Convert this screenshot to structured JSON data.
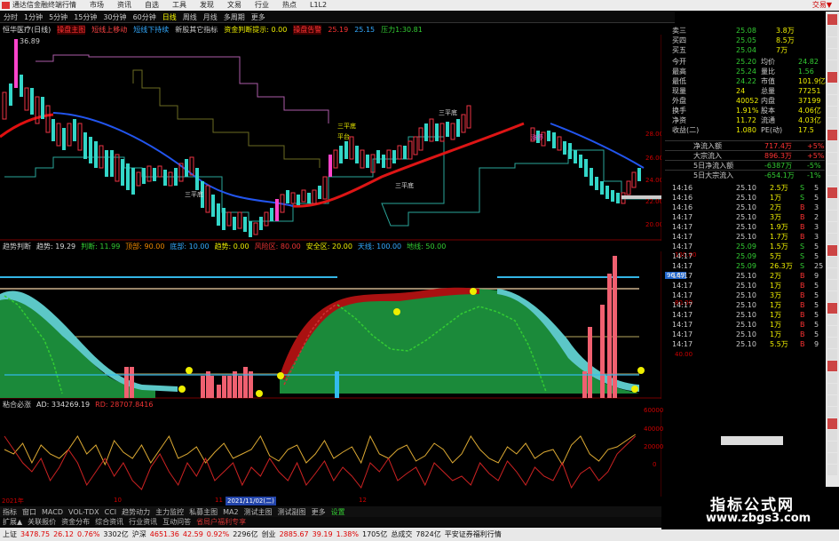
{
  "window": {
    "title": "通达信金融终端",
    "menus": [
      "行情",
      "市场",
      "资讯",
      "自选",
      "工具",
      "发现",
      "文易",
      "行业",
      "热点",
      "L1L2"
    ],
    "right_label": "交易▼"
  },
  "timeframes": {
    "items": [
      "分时",
      "1分钟",
      "5分钟",
      "15分钟",
      "30分钟",
      "60分钟",
      "日线",
      "周线",
      "月线",
      "多周期",
      "更多"
    ],
    "selected": "日线"
  },
  "main_indicator": {
    "stock": "恒华医疗(日线)",
    "items": [
      "操盘主图",
      "短线上移动",
      "短线下持续",
      "新股其它指标",
      "资金判断提示: 0.00",
      "操盘告警",
      "25.19",
      "25.15",
      "压力1:30.81"
    ],
    "price_high": "36.89",
    "labels": [
      "三平底",
      "三平底",
      "三平底",
      "三平底",
      "平台",
      "涨停"
    ]
  },
  "y_axis_main": [
    "28.00",
    "26.00",
    "24.00",
    "22.00",
    "20.00"
  ],
  "sub1": {
    "items": [
      "趋势判断",
      "趋势: 19.29",
      "判断: 11.99",
      "顶部: 90.00",
      "底部: 10.00",
      "趋势: 0.00",
      "风险区: 80.00",
      "安全区: 20.00",
      "天线: 100.00",
      "地线: 50.00"
    ],
    "y_axis": [
      "120.00",
      "80.00",
      "40.00"
    ],
    "marker": "96.69"
  },
  "sub2": {
    "items": [
      "粘合必涨",
      "AD: 334269.19",
      "RD: 28707.8416"
    ],
    "y_axis": [
      "60000",
      "40000",
      "20000",
      "0"
    ]
  },
  "date_axis": [
    "2021年",
    "10",
    "11",
    "2021/11/02(二)",
    "12"
  ],
  "bottom_tabs": [
    "指标",
    "窗口",
    "MACD",
    "VOL-TDX",
    "CCI",
    "趋势动力",
    "主力监控",
    "私募主图",
    "MA2",
    "测试主图",
    "测试副图",
    "更多",
    "设置"
  ],
  "bottom_tabs2": [
    "扩展▲",
    "关联报价",
    "资金分布",
    "综合资讯",
    "行业资讯",
    "互动问答",
    "省局户福利专享"
  ],
  "status": {
    "sh_label": "上证",
    "sh_val": "3478.75",
    "sh_chg": "26.12",
    "sh_pct": "0.76%",
    "sh_amt": "3302亿",
    "sz_label": "沪深",
    "sz_val": "4651.36",
    "sz_chg": "42.59",
    "sz_pct": "0.92%",
    "sz_amt": "2296亿",
    "cy_label": "创业",
    "cy_val": "2885.67",
    "cy_chg": "39.19",
    "cy_pct": "1.38%",
    "cy_amt": "1705亿",
    "total_label": "总成交",
    "total_amt": "7824亿",
    "broker": "平安证券福利行情"
  },
  "quote": {
    "top": [
      {
        "k": "卖三",
        "v": "25.08",
        "n": "3.8万"
      },
      {
        "k": "买四",
        "v": "25.05",
        "n": "8.5万"
      },
      {
        "k": "买五",
        "v": "25.04",
        "n": "7万"
      }
    ],
    "stats": [
      {
        "k1": "今开",
        "v1": "25.20",
        "k2": "均价",
        "v2": "24.82"
      },
      {
        "k1": "最高",
        "v1": "25.24",
        "k2": "量比",
        "v2": "1.56"
      },
      {
        "k1": "最低",
        "v1": "24.22",
        "k2": "市值",
        "v2": "101.9亿"
      },
      {
        "k1": "现量",
        "v1": "24",
        "k2": "总量",
        "v2": "77251"
      },
      {
        "k1": "外盘",
        "v1": "40052",
        "k2": "内盘",
        "v2": "37199"
      },
      {
        "k1": "换手",
        "v1": "1.91%",
        "k2": "股本",
        "v2": "4.06亿"
      },
      {
        "k1": "净资",
        "v1": "11.72",
        "k2": "流通",
        "v2": "4.03亿"
      },
      {
        "k1": "收益(二)",
        "v1": "1.080",
        "k2": "PE(动)",
        "v2": "17.5"
      }
    ],
    "flow": [
      {
        "k": "净流入额",
        "v": "717.4万",
        "p": "+5%"
      },
      {
        "k": "大宗流入",
        "v": "896.3万",
        "p": "+5%"
      },
      {
        "k": "5日净流入额",
        "v": "-6387万",
        "p": "-5%"
      },
      {
        "k": "5日大宗流入",
        "v": "-654.1万",
        "p": "-1%"
      }
    ],
    "ticks": [
      {
        "t": "14:16",
        "p": "25.10",
        "v": "2.5万",
        "s": "S",
        "n": "5"
      },
      {
        "t": "14:16",
        "p": "25.10",
        "v": "1万",
        "s": "S",
        "n": "5"
      },
      {
        "t": "14:16",
        "p": "25.10",
        "v": "2万",
        "s": "B",
        "n": "3"
      },
      {
        "t": "14:17",
        "p": "25.10",
        "v": "3万",
        "s": "B",
        "n": "2"
      },
      {
        "t": "14:17",
        "p": "25.10",
        "v": "1.9万",
        "s": "B",
        "n": "3"
      },
      {
        "t": "14:17",
        "p": "25.10",
        "v": "1.7万",
        "s": "B",
        "n": "3"
      },
      {
        "t": "14:17",
        "p": "25.09",
        "v": "1.5万",
        "s": "S",
        "n": "5"
      },
      {
        "t": "14:17",
        "p": "25.09",
        "v": "5万",
        "s": "S",
        "n": "5"
      },
      {
        "t": "14:17",
        "p": "25.09",
        "v": "26.3万",
        "s": "S",
        "n": "25"
      },
      {
        "t": "14:17",
        "p": "25.10",
        "v": "2万",
        "s": "B",
        "n": "9"
      },
      {
        "t": "14:17",
        "p": "25.10",
        "v": "1万",
        "s": "B",
        "n": "5"
      },
      {
        "t": "14:17",
        "p": "25.10",
        "v": "3万",
        "s": "B",
        "n": "5"
      },
      {
        "t": "14:17",
        "p": "25.10",
        "v": "1万",
        "s": "B",
        "n": "5"
      },
      {
        "t": "14:17",
        "p": "25.10",
        "v": "1万",
        "s": "B",
        "n": "5"
      },
      {
        "t": "14:17",
        "p": "25.10",
        "v": "1万",
        "s": "B",
        "n": "5"
      },
      {
        "t": "14:17",
        "p": "25.10",
        "v": "1万",
        "s": "B",
        "n": "5"
      },
      {
        "t": "14:17",
        "p": "25.10",
        "v": "5.5万",
        "s": "B",
        "n": "9"
      }
    ]
  },
  "logo": {
    "line1": "指标公式网",
    "line2": "www.zbgs3.com"
  }
}
